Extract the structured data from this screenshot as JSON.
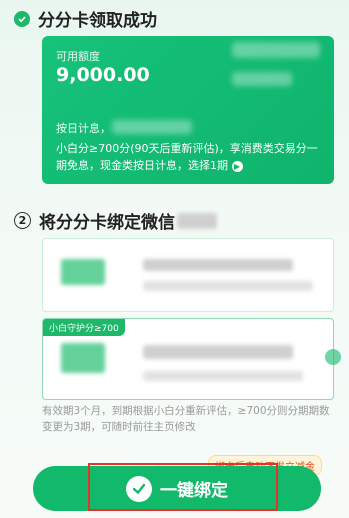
{
  "section1": {
    "title": "分分卡领取成功"
  },
  "card": {
    "label": "可用额度",
    "amount": "9,000.00",
    "interest_label": "按日计息，",
    "description": "小白分≥700分(90天后重新评估)，享消费类交易分一期免息，现金类按日计息，选择1期"
  },
  "section2": {
    "number": "2",
    "title": "将分分卡绑定微信"
  },
  "list2": {
    "badge": "小白守护分≥700"
  },
  "footnote": "有效期3个月，到期根据小白分重新评估，≥700分则分期期数变更为3期，可随时前往主页修改",
  "promo": "绑卡后自动下发立减金",
  "button": {
    "label": "一键绑定"
  },
  "colors": {
    "brand_green": "#12b96a",
    "highlight_red": "#e8312a"
  }
}
